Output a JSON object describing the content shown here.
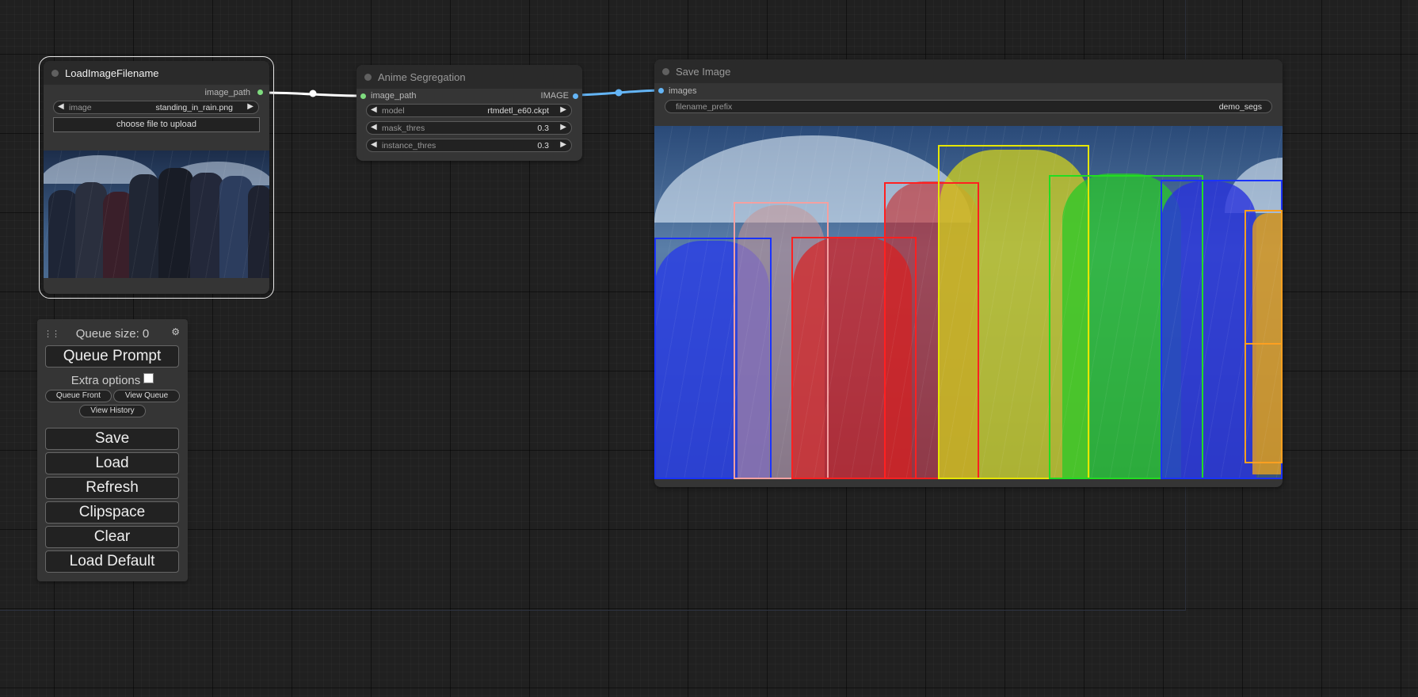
{
  "nodes": {
    "load_image": {
      "title": "LoadImageFilename",
      "output": "image_path",
      "image_widget": {
        "label": "image",
        "value": "standing_in_rain.png"
      },
      "upload_button": "choose file to upload"
    },
    "anime_seg": {
      "title": "Anime Segregation",
      "input": "image_path",
      "output": "IMAGE",
      "widgets": [
        {
          "label": "model",
          "value": "rtmdetl_e60.ckpt"
        },
        {
          "label": "mask_thres",
          "value": "0.3"
        },
        {
          "label": "instance_thres",
          "value": "0.3"
        }
      ]
    },
    "save_image": {
      "title": "Save Image",
      "input": "images",
      "filename_widget": {
        "label": "filename_prefix",
        "value": "demo_segs"
      }
    }
  },
  "menu": {
    "queue_size": "Queue size: 0",
    "queue_prompt": "Queue Prompt",
    "extra_options": "Extra options",
    "extra_options_checked": false,
    "queue_front": "Queue Front",
    "view_queue": "View Queue",
    "view_history": "View History",
    "save": "Save",
    "load": "Load",
    "refresh": "Refresh",
    "clipspace": "Clipspace",
    "clear": "Clear",
    "load_default": "Load Default"
  },
  "colors": {
    "link_image_path": "#ffffff",
    "link_image": "#64b5f6",
    "slot_string": "#7fdc7f",
    "slot_image": "#64b5f6",
    "seg_blue": "#1a33ff",
    "seg_pink": "#f4a0a0",
    "seg_red": "#ff2020",
    "seg_yellow": "#e6e600",
    "seg_green": "#22dd22",
    "seg_orange": "#ffa020"
  },
  "icons": {
    "arrow_left": "◀",
    "arrow_right": "▶",
    "gear": "⚙",
    "drag": "⋮⋮"
  }
}
